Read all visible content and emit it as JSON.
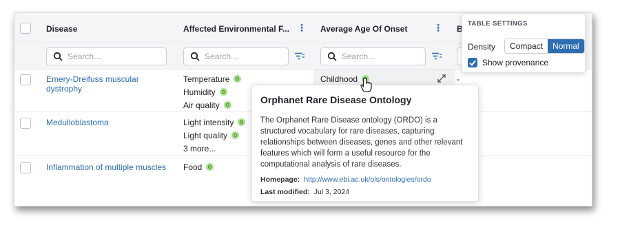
{
  "columns": {
    "disease": "Disease",
    "environmental": "Affected Environmental F...",
    "age_onset": "Average Age Of Onset",
    "partial": "B"
  },
  "search": {
    "placeholder": "Search..."
  },
  "rows": [
    {
      "disease": "Emery-Dreifuss muscular dystrophy",
      "factors": [
        "Temperature",
        "Humidity",
        "Air quality"
      ],
      "onset": "Childhood",
      "extra": "-"
    },
    {
      "disease": "Medulloblastoma",
      "factors": [
        "Light intensity",
        "Light quality"
      ],
      "more": "3 more..."
    },
    {
      "disease": "Inflammation of multiple muscles",
      "factors": [
        "Food"
      ]
    }
  ],
  "popover": {
    "title": "Orphanet Rare Disease Ontology",
    "description": "The Orphanet Rare Disease ontology (ORDO) is a structured vocabulary for rare diseases, capturing relationships between diseases, genes and other relevant features which will form a useful resource for the computational analysis of rare diseases.",
    "homepage_label": "Homepage:",
    "homepage_url": "http://www.ebi.ac.uk/ols/ontologies/ordo",
    "modified_label": "Last modified:",
    "modified_value": "Jul 3, 2024"
  },
  "settings": {
    "title": "TABLE SETTINGS",
    "density_label": "Density",
    "options": [
      "Compact",
      "Normal"
    ],
    "selected": "Normal",
    "provenance_label": "Show provenance",
    "provenance_checked": true
  },
  "colors": {
    "link": "#2a6db0",
    "accent": "#2d6db1",
    "provenance_dot": "#a6e08a"
  }
}
